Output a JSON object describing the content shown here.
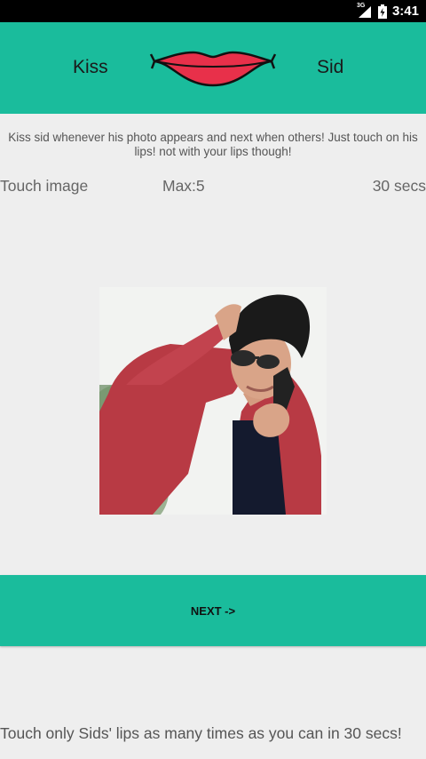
{
  "status_bar": {
    "network_type": "3G",
    "time": "3:41"
  },
  "header": {
    "left_text": "Kiss",
    "right_text": "Sid",
    "logo_icon": "lips-icon",
    "background": "#1abc9c"
  },
  "instructions": {
    "line1": "Kiss sid whenever his photo appears and next when others! Just touch on his",
    "line2": "lips! not with your lips though!"
  },
  "info": {
    "action": "Touch image",
    "max_label": "Max:5",
    "timer": "30 secs"
  },
  "photo": {
    "icon": "man-photo-image"
  },
  "next_button": {
    "label": "NEXT ->"
  },
  "footer": {
    "text": "Touch only Sids' lips as many times as you can in 30 secs!"
  },
  "colors": {
    "accent": "#1abc9c",
    "background": "#eeeeee",
    "lips": "#e8304a"
  }
}
